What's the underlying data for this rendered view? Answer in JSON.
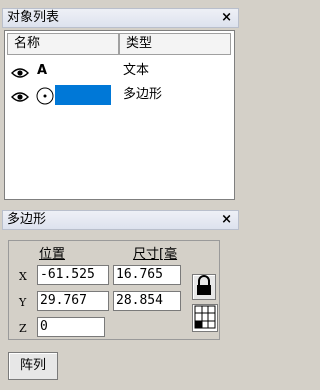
{
  "object_list": {
    "title": "对象列表",
    "close_label": "×",
    "col_name": "名称",
    "col_type": "类型",
    "rows": [
      {
        "name": "A",
        "type": "文本"
      },
      {
        "name": "",
        "type": "多边形"
      }
    ]
  },
  "polygon_panel": {
    "title": "多边形",
    "close_label": "×",
    "pos_header": "位置",
    "size_header": "尺寸[毫",
    "x_label": "X",
    "y_label": "Y",
    "z_label": "Z",
    "x_pos": "-61.525",
    "x_size": "16.765",
    "y_pos": "29.767",
    "y_size": "28.854",
    "z_value": "0",
    "array_button": "阵列"
  },
  "colors": {
    "selection": "#0078d7"
  }
}
